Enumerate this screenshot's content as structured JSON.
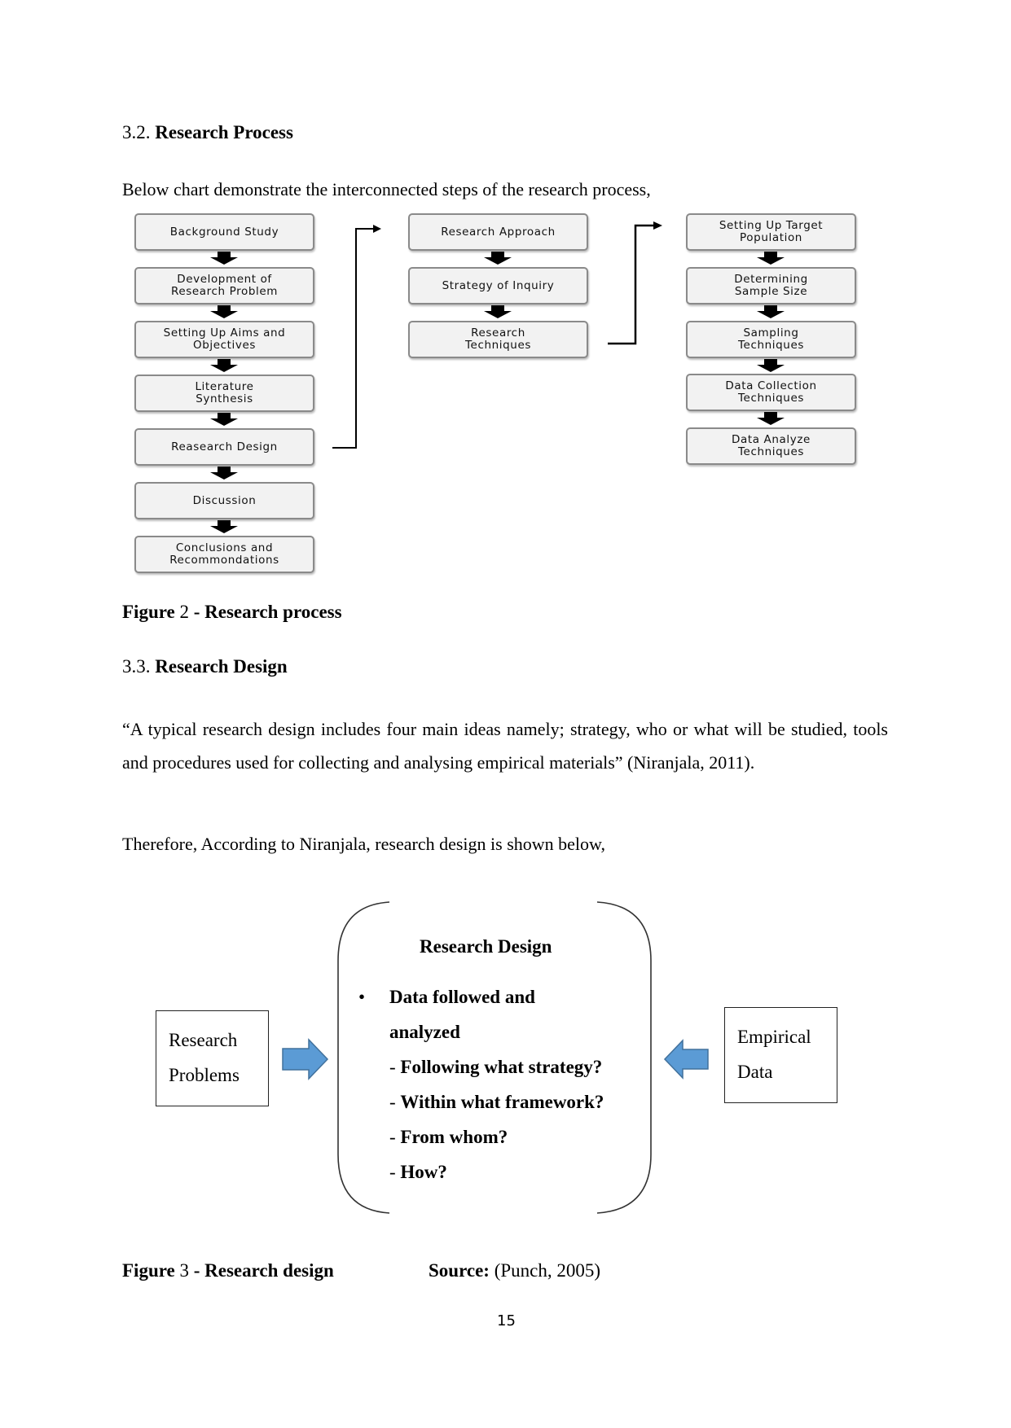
{
  "section_3_2": {
    "number": "3.2.",
    "title": "Research Process",
    "intro": "Below chart demonstrate the interconnected steps of the research process,"
  },
  "flowchart": {
    "column1": [
      "Background Study",
      "Development of Research Problem",
      "Setting Up Aims and Objectives",
      "Literature Synthesis",
      "Reasearch Design",
      "Discussion",
      "Conclusions and Recommondations"
    ],
    "column2": [
      "Research Approach",
      "Strategy of Inquiry",
      "Research Techniques"
    ],
    "column3": [
      "Setting Up Target Population",
      "Determining Sample Size",
      "Sampling Techniques",
      "Data Collection Techniques",
      "Data Analyze Techniques"
    ]
  },
  "figure2": {
    "prefix": "Figure",
    "number": "2",
    "title": "- Research process"
  },
  "section_3_3": {
    "number": "3.3.",
    "title": "Research Design",
    "quote": "“A typical research design includes four main ideas namely; strategy, who or what will be studied, tools and procedures used for collecting and analysing empirical materials” (Niranjala, 2011).",
    "lead_in": "Therefore, According to Niranjala, research design is shown below,"
  },
  "design_diagram": {
    "left_box": [
      "Research",
      "Problems"
    ],
    "right_box": [
      "Empirical",
      "Data"
    ],
    "center_title": "Research Design",
    "bullet": [
      "Data followed and",
      "analyzed"
    ],
    "questions": [
      "Following what strategy?",
      "Within what framework?",
      "From whom?",
      "How?"
    ],
    "arrow_color": "#5b9bd5",
    "arrow_border": "#41719c"
  },
  "figure3": {
    "prefix": "Figure",
    "number": "3",
    "title": "- Research design",
    "source_label": "Source:",
    "source_value": "(Punch, 2005)"
  },
  "page_number": "15"
}
